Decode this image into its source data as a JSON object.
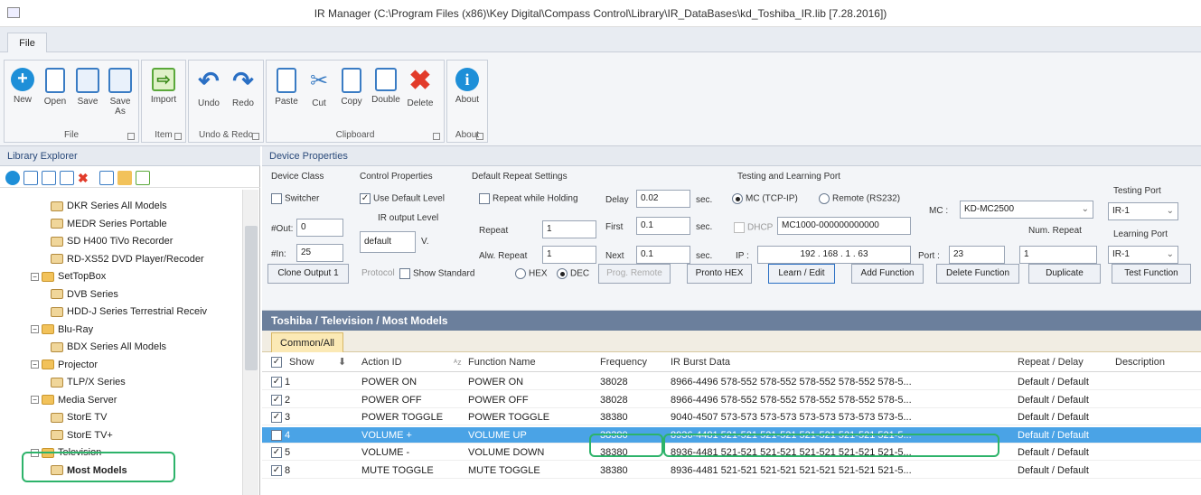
{
  "window": {
    "title": "IR Manager (C:\\Program Files (x86)\\Key Digital\\Compass Control\\Library\\IR_DataBases\\kd_Toshiba_IR.lib [7.28.2016])"
  },
  "menu": {
    "file_tab": "File"
  },
  "ribbon": {
    "groups": {
      "file": "File",
      "item": "Item",
      "undo_redo": "Undo & Redo",
      "clipboard": "Clipboard",
      "about": "About"
    },
    "buttons": {
      "new": "New",
      "open": "Open",
      "save": "Save",
      "save_as": "Save As",
      "import": "Import",
      "undo": "Undo",
      "redo": "Redo",
      "paste": "Paste",
      "cut": "Cut",
      "copy": "Copy",
      "double": "Double",
      "delete": "Delete",
      "about": "About"
    }
  },
  "library_explorer": {
    "header": "Library Explorer",
    "tree": [
      {
        "label": "DKR Series All Models",
        "kind": "doc",
        "level": 3
      },
      {
        "label": "MEDR Series Portable",
        "kind": "doc",
        "level": 3
      },
      {
        "label": "SD H400 TiVo Recorder",
        "kind": "doc",
        "level": 3
      },
      {
        "label": "RD-XS52 DVD Player/Recoder",
        "kind": "doc",
        "level": 3
      },
      {
        "label": "SetTopBox",
        "kind": "folder",
        "level": 2
      },
      {
        "label": "DVB Series",
        "kind": "doc",
        "level": 3
      },
      {
        "label": "HDD-J Series Terrestrial Receiv",
        "kind": "doc",
        "level": 3
      },
      {
        "label": "Blu-Ray",
        "kind": "folder",
        "level": 2
      },
      {
        "label": "BDX Series All Models",
        "kind": "doc",
        "level": 3
      },
      {
        "label": "Projector",
        "kind": "folder",
        "level": 2
      },
      {
        "label": "TLP/X Series",
        "kind": "doc",
        "level": 3
      },
      {
        "label": "Media Server",
        "kind": "folder",
        "level": 2
      },
      {
        "label": "StorE TV",
        "kind": "doc",
        "level": 3
      },
      {
        "label": "StorE TV+",
        "kind": "doc",
        "level": 3
      },
      {
        "label": "Television",
        "kind": "folder",
        "level": 2
      },
      {
        "label": "Most Models",
        "kind": "doc",
        "level": 3,
        "bold": true
      }
    ]
  },
  "device_properties": {
    "header": "Device Properties",
    "device_class": {
      "title": "Device Class",
      "switcher": "Switcher",
      "out_label": "#Out:",
      "out_value": "0",
      "in_label": "#In:",
      "in_value": "25"
    },
    "control_properties": {
      "title": "Control Properties",
      "use_default_level": "Use Default Level",
      "ir_output_level": "IR output Level",
      "level_value": "default",
      "unit": "V."
    },
    "default_repeat": {
      "title": "Default Repeat Settings",
      "repeat_while_holding": "Repeat while Holding",
      "repeat_label": "Repeat",
      "repeat_value": "1",
      "alw_repeat_label": "Alw. Repeat",
      "alw_repeat_value": "1",
      "delay_label": "Delay",
      "delay_value": "0.02",
      "first_label": "First",
      "first_value": "0.1",
      "next_label": "Next",
      "next_value": "0.1",
      "sec": "sec."
    },
    "testing": {
      "title": "Testing and Learning Port",
      "mc_tcpip": "MC (TCP-IP)",
      "remote_rs232": "Remote (RS232)",
      "mc_label": "MC :",
      "mc_value": "KD-MC2500",
      "dhcp": "DHCP",
      "dhcp_value": "MC1000-000000000000",
      "ip_label": "IP :",
      "ip_value": "192 . 168 . 1 . 63",
      "port_label": "Port :",
      "port_value": "23",
      "num_repeat_label": "Num. Repeat",
      "num_repeat_value": "1",
      "testing_port_label": "Testing Port",
      "testing_port_value": "IR-1",
      "learning_port_label": "Learning Port",
      "learning_port_value": "IR-1"
    },
    "buttons": {
      "clone_output": "Clone Output 1",
      "protocol": "Protocol",
      "show_standard": "Show Standard",
      "hex": "HEX",
      "dec": "DEC",
      "prog_remote": "Prog. Remote",
      "pronto_hex": "Pronto HEX",
      "learn_edit": "Learn / Edit",
      "add_function": "Add Function",
      "delete_function": "Delete Function",
      "duplicate": "Duplicate",
      "test_function": "Test Function"
    }
  },
  "path_bar": "Toshiba / Television / Most Models",
  "tabs": [
    "Common/All"
  ],
  "grid": {
    "headers": {
      "show": "Show",
      "action_id": "Action ID",
      "function_name": "Function Name",
      "frequency": "Frequency",
      "burst": "IR Burst Data",
      "repeat_delay": "Repeat / Delay",
      "description": "Description"
    },
    "rows": [
      {
        "id": "1",
        "action": "POWER ON",
        "func": "POWER ON",
        "freq": "38028",
        "burst": "8966-4496 578-552 578-552 578-552 578-552 578-5...",
        "rd": "Default / Default"
      },
      {
        "id": "2",
        "action": "POWER OFF",
        "func": "POWER OFF",
        "freq": "38028",
        "burst": "8966-4496 578-552 578-552 578-552 578-552 578-5...",
        "rd": "Default / Default"
      },
      {
        "id": "3",
        "action": "POWER TOGGLE",
        "func": "POWER TOGGLE",
        "freq": "38380",
        "burst": "9040-4507 573-573 573-573 573-573 573-573 573-5...",
        "rd": "Default / Default"
      },
      {
        "id": "4",
        "action": "VOLUME +",
        "func": "VOLUME UP",
        "freq": "38380",
        "burst": "8936-4481 521-521 521-521 521-521 521-521 521-5...",
        "rd": "Default / Default",
        "selected": true
      },
      {
        "id": "5",
        "action": "VOLUME -",
        "func": "VOLUME DOWN",
        "freq": "38380",
        "burst": "8936-4481 521-521 521-521 521-521 521-521 521-5...",
        "rd": "Default / Default"
      },
      {
        "id": "8",
        "action": "MUTE TOGGLE",
        "func": "MUTE TOGGLE",
        "freq": "38380",
        "burst": "8936-4481 521-521 521-521 521-521 521-521 521-5...",
        "rd": "Default / Default"
      }
    ]
  },
  "colors": {
    "accent": "#2db36a",
    "selection": "#4aa3e6"
  }
}
